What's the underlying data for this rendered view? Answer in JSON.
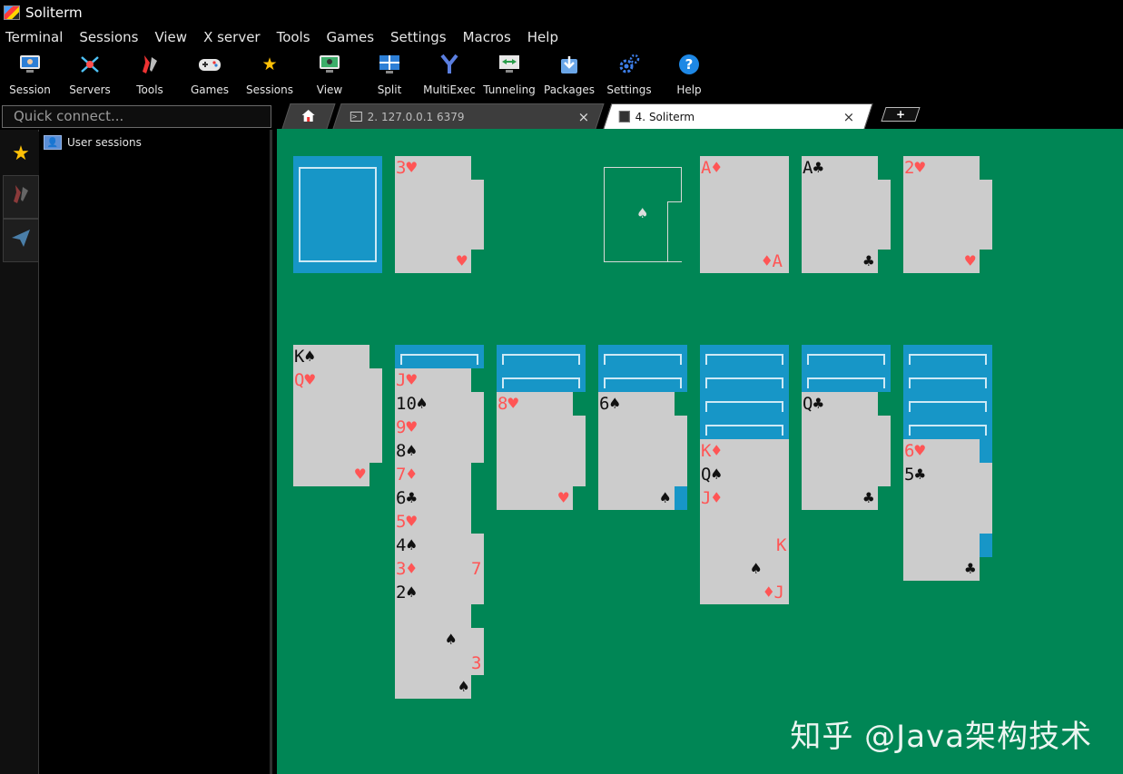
{
  "window": {
    "title": "Soliterm"
  },
  "menu": [
    "Terminal",
    "Sessions",
    "View",
    "X server",
    "Tools",
    "Games",
    "Settings",
    "Macros",
    "Help"
  ],
  "toolbar": [
    {
      "label": "Session",
      "icon": "monitor-icon"
    },
    {
      "label": "Servers",
      "icon": "servers-icon"
    },
    {
      "label": "Tools",
      "icon": "tools-icon"
    },
    {
      "label": "Games",
      "icon": "gamepad-icon"
    },
    {
      "label": "Sessions",
      "icon": "star-icon"
    },
    {
      "label": "View",
      "icon": "view-icon"
    },
    {
      "label": "Split",
      "icon": "split-icon"
    },
    {
      "label": "MultiExec",
      "icon": "fork-icon"
    },
    {
      "label": "Tunneling",
      "icon": "tunnel-icon"
    },
    {
      "label": "Packages",
      "icon": "download-icon"
    },
    {
      "label": "Settings",
      "icon": "gears-icon"
    },
    {
      "label": "Help",
      "icon": "help-icon"
    }
  ],
  "quick_connect": {
    "placeholder": "Quick connect..."
  },
  "sessions": {
    "items": [
      "User sessions"
    ]
  },
  "tabs": [
    {
      "label": "",
      "icon": "home-icon"
    },
    {
      "label": "2.  127.0.0.1 6379",
      "close": "×"
    },
    {
      "label": "4.  Soliterm",
      "close": "×"
    }
  ],
  "new_tab": "+",
  "game": {
    "foundation_slot": "♠",
    "waste": {
      "label": "3♥",
      "corner": "♥"
    },
    "foundations": [
      {
        "label": "A♦",
        "corner": "♦A",
        "color": "red"
      },
      {
        "label": "A♣",
        "corner": "♣",
        "color": "blk"
      },
      {
        "label": "2♥",
        "corner": "♥",
        "color": "red"
      }
    ],
    "columns": [
      {
        "backs": 0,
        "cards": [
          {
            "t": "K♠",
            "c": "blk"
          },
          {
            "t": "Q♥",
            "c": "red"
          }
        ],
        "corner": "♥",
        "cornerColor": "red"
      },
      {
        "backs": 1,
        "cards": [
          {
            "t": "J♥",
            "c": "red"
          },
          {
            "t": "10♠",
            "c": "blk"
          },
          {
            "t": "9♥",
            "c": "red"
          },
          {
            "t": "8♠",
            "c": "blk"
          },
          {
            "t": "7♦",
            "c": "red"
          },
          {
            "t": "6♣",
            "c": "blk"
          },
          {
            "t": "5♥",
            "c": "red"
          },
          {
            "t": "4♠",
            "c": "blk"
          },
          {
            "t": "3♦",
            "c": "red"
          },
          {
            "t": "2♠",
            "c": "blk"
          }
        ],
        "extra": [
          {
            "t": "7",
            "c": "red"
          },
          {
            "t": "♠",
            "c": "blk"
          },
          {
            "t": "3",
            "c": "red"
          },
          {
            "t": "♠",
            "c": "blk"
          }
        ]
      },
      {
        "backs": 2,
        "cards": [
          {
            "t": "8♥",
            "c": "red"
          }
        ],
        "corner": "♥",
        "cornerColor": "red"
      },
      {
        "backs": 2,
        "cards": [
          {
            "t": "6♠",
            "c": "blk"
          }
        ],
        "corner": "♠",
        "cornerColor": "blk"
      },
      {
        "backs": 4,
        "cards": [
          {
            "t": "K♦",
            "c": "red"
          },
          {
            "t": "Q♠",
            "c": "blk"
          },
          {
            "t": "J♦",
            "c": "red"
          }
        ],
        "extra": [
          {
            "t": "K",
            "c": "red"
          },
          {
            "t": "♠",
            "c": "blk"
          },
          {
            "t": "♦J",
            "c": "red"
          }
        ]
      },
      {
        "backs": 2,
        "cards": [
          {
            "t": "Q♣",
            "c": "blk"
          }
        ],
        "corner": "♣",
        "cornerColor": "blk"
      },
      {
        "backs": 4,
        "cards": [
          {
            "t": "6♥",
            "c": "red"
          },
          {
            "t": "5♣",
            "c": "blk"
          }
        ],
        "corner": "♣",
        "cornerColor": "blk"
      }
    ]
  },
  "watermark": "知乎 @Java架构技术",
  "colors": {
    "felt": "#008655",
    "card": "#cccccc",
    "back": "#1796c7",
    "red": "#ff5555"
  }
}
